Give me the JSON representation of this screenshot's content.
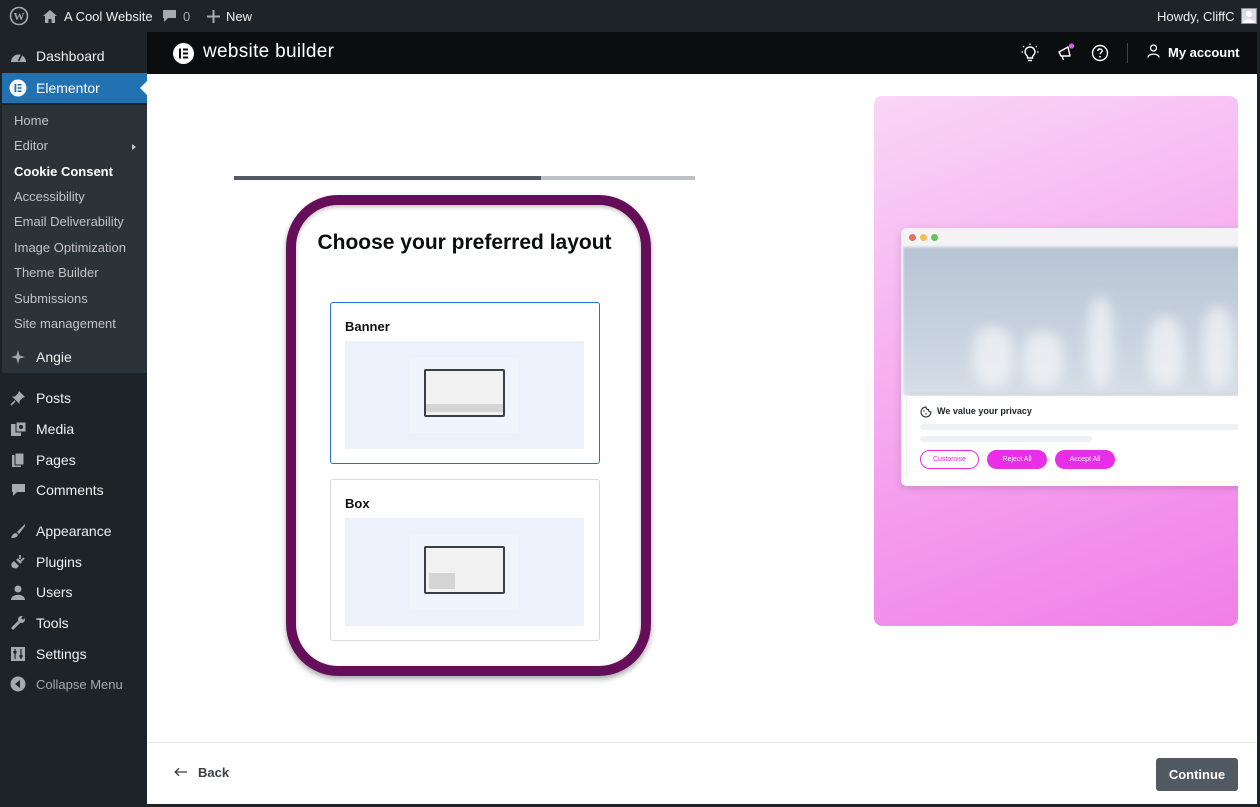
{
  "adminbar": {
    "site_name": "A Cool Website",
    "comments_count": "0",
    "new_label": "New",
    "howdy": "Howdy, CliffC"
  },
  "sidebar": {
    "dashboard": "Dashboard",
    "elementor": "Elementor",
    "submenu": [
      "Home",
      "Editor",
      "Cookie Consent",
      "Accessibility",
      "Email Deliverability",
      "Image Optimization",
      "Theme Builder",
      "Submissions",
      "Site management"
    ],
    "angie": "Angie",
    "posts": "Posts",
    "media": "Media",
    "pages": "Pages",
    "comments": "Comments",
    "appearance": "Appearance",
    "plugins": "Plugins",
    "users": "Users",
    "tools": "Tools",
    "settings": "Settings",
    "collapse": "Collapse Menu"
  },
  "header": {
    "title": "website builder",
    "account": "My account",
    "notification_color": "#e355f0"
  },
  "wizard": {
    "progress_fraction": 0.667,
    "heading": "Choose your preferred layout",
    "options": [
      {
        "label": "Banner",
        "selected": true
      },
      {
        "label": "Box",
        "selected": false
      }
    ]
  },
  "preview": {
    "consent_title": "We value your privacy",
    "customise": "Customise",
    "reject": "Reject All",
    "accept": "Accept All",
    "accent_color": "#e92ee8"
  },
  "footer": {
    "back": "Back",
    "continue": "Continue"
  }
}
